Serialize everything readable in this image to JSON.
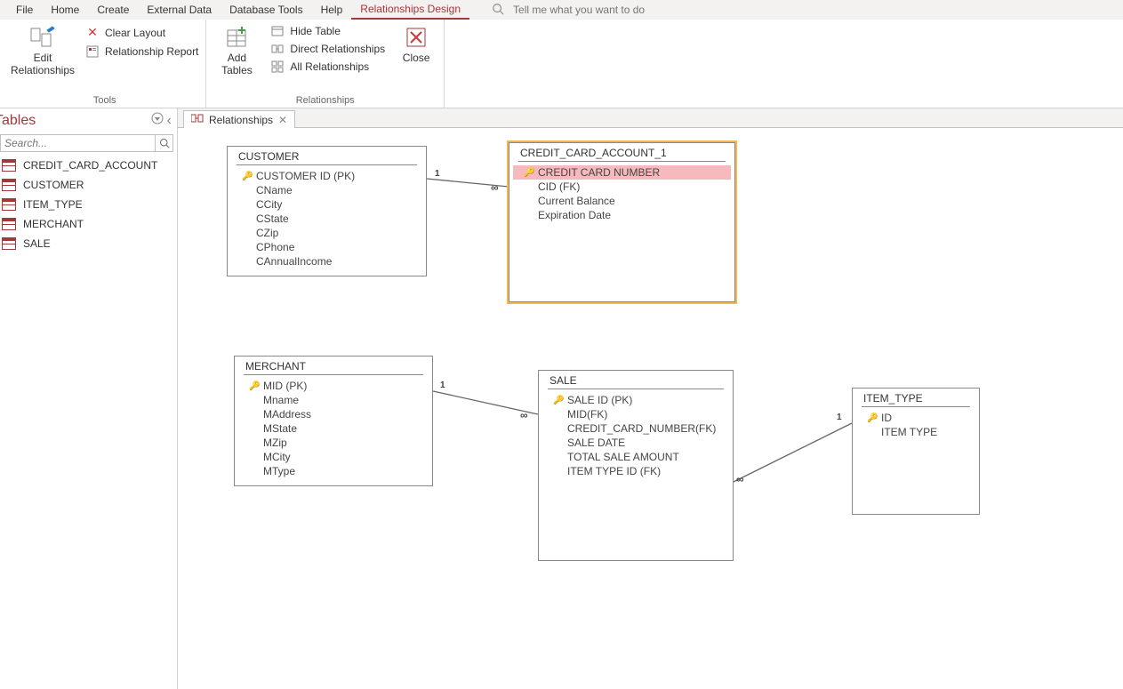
{
  "menu": {
    "tabs": [
      "File",
      "Home",
      "Create",
      "External Data",
      "Database Tools",
      "Help",
      "Relationships Design"
    ],
    "active_index": 6,
    "tell_me_placeholder": "Tell me what you want to do"
  },
  "ribbon": {
    "tools_group_label": "Tools",
    "relationships_group_label": "Relationships",
    "edit_relationships": "Edit Relationships",
    "clear_layout": "Clear Layout",
    "relationship_report": "Relationship Report",
    "add_tables": "Add Tables",
    "hide_table": "Hide Table",
    "direct_relationships": "Direct Relationships",
    "all_relationships": "All Relationships",
    "close": "Close"
  },
  "nav": {
    "header": "Tables",
    "search_placeholder": "Search...",
    "items": [
      "CREDIT_CARD_ACCOUNT",
      "CUSTOMER",
      "ITEM_TYPE",
      "MERCHANT",
      "SALE"
    ]
  },
  "doc_tab": {
    "title": "Relationships"
  },
  "entities": {
    "customer": {
      "title": "CUSTOMER",
      "fields": [
        "CUSTOMER ID (PK)",
        "CName",
        "CCity",
        "CState",
        "CZip",
        "CPhone",
        "CAnnualIncome"
      ],
      "key_indices": [
        0
      ]
    },
    "cca": {
      "title": "CREDIT_CARD_ACCOUNT_1",
      "fields": [
        "CREDIT CARD NUMBER",
        "CID (FK)",
        "Current Balance",
        "Expiration Date"
      ],
      "key_indices": [
        0
      ],
      "highlight_index": 0
    },
    "merchant": {
      "title": "MERCHANT",
      "fields": [
        "MID (PK)",
        "Mname",
        "MAddress",
        "MState",
        "MZip",
        "MCity",
        "MType"
      ],
      "key_indices": [
        0
      ]
    },
    "sale": {
      "title": "SALE",
      "fields": [
        "SALE ID (PK)",
        "MID(FK)",
        "CREDIT_CARD_NUMBER(FK)",
        "SALE DATE",
        "TOTAL SALE AMOUNT",
        "ITEM TYPE ID (FK)"
      ],
      "key_indices": [
        0
      ]
    },
    "item_type": {
      "title": "ITEM_TYPE",
      "fields": [
        "ID",
        "ITEM TYPE"
      ],
      "key_indices": [
        0
      ]
    }
  },
  "relations": {
    "one": "1",
    "many": "∞"
  }
}
